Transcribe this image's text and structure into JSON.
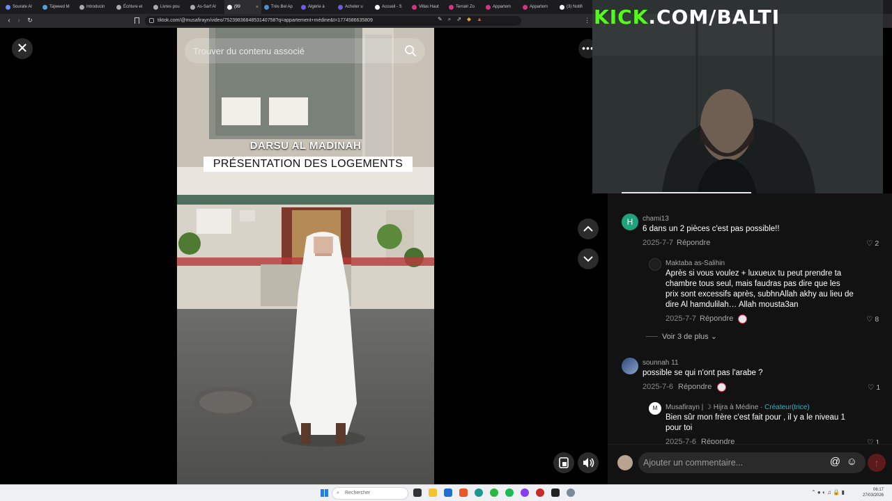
{
  "browser": {
    "tabs": [
      {
        "label": "Sourate Al",
        "color": "#6b8cff"
      },
      {
        "label": "Tajweed M",
        "color": "#4aa3df"
      },
      {
        "label": "Introducin",
        "color": "#aaaaaa"
      },
      {
        "label": "Écriture et",
        "color": "#aaaaaa"
      },
      {
        "label": "Livres pou",
        "color": "#aaaaaa"
      },
      {
        "label": "As-Sarf Al",
        "color": "#aaaaaa"
      },
      {
        "label": "(99",
        "color": "#ffffff"
      },
      {
        "label": "Très Bel Ap",
        "color": "#4a90d9"
      },
      {
        "label": "Algérie à",
        "color": "#6c5ce7"
      },
      {
        "label": "Acheter u",
        "color": "#6c5ce7"
      },
      {
        "label": "Accueil - S",
        "color": "#ffffff"
      },
      {
        "label": "Villas Haut",
        "color": "#d63384"
      },
      {
        "label": "Terrain Zo",
        "color": "#d63384"
      },
      {
        "label": "Appartem",
        "color": "#d63384"
      },
      {
        "label": "Appartem",
        "color": "#d63384"
      },
      {
        "label": "(3) Notifi",
        "color": "#ffffff"
      }
    ],
    "active_tab_index": 6,
    "url": "tiktok.com/@musafirayn/video/7523983684853140758?q=appartement+médine&t=1774586635809"
  },
  "video": {
    "search_placeholder": "Trouver du contenu associé",
    "overlay_title": "DARSU AL MADINAH",
    "overlay_subtitle": "PRÉSENTATION DES LOGEMENTS"
  },
  "stream": {
    "kick_prefix": "KICK",
    "kick_suffix": ".COM/BALTI"
  },
  "comments": [
    {
      "user": "chami13",
      "avatar_letter": "H",
      "avatar_color": "#1fa37c",
      "text": "6 dans un 2 pièces c'est pas possible!!",
      "date": "2025-7-7",
      "reply_label": "Répondre",
      "likes": "2"
    },
    {
      "user": "Maktaba as-Salihin",
      "text_lines": [
        "Après si vous voulez + luxueux tu peut prendre ta",
        "chambre tous seul, mais faudras pas dire que les",
        "prix sont excessifs après, subhnAllah akhy au lieu de",
        "dire Al hamdulilah… Allah mousta3an"
      ],
      "date": "2025-7-7",
      "reply_label": "Répondre",
      "likes": "8"
    },
    {
      "more": "Voir 3 de plus"
    },
    {
      "user": "sounnah 11",
      "text": "possible se qui n'ont pas l'arabe ?",
      "date": "2025-7-6",
      "reply_label": "Répondre",
      "likes": "1"
    },
    {
      "user": "Musafirayn | ☽ Hijra à Médine",
      "creator_badge": "Créateur(trice)",
      "avatar_letter": "M",
      "text_lines": [
        "Bien sûr mon frère c'est fait pour , il y a le niveau 1",
        "pour toi"
      ],
      "date": "2025-7-6",
      "reply_label": "Répondre",
      "likes": "1"
    }
  ],
  "add_comment_placeholder": "Ajouter un commentaire...",
  "taskbar": {
    "search_label": "Rechercher",
    "time": "06:17",
    "date": "27/03/2026"
  }
}
